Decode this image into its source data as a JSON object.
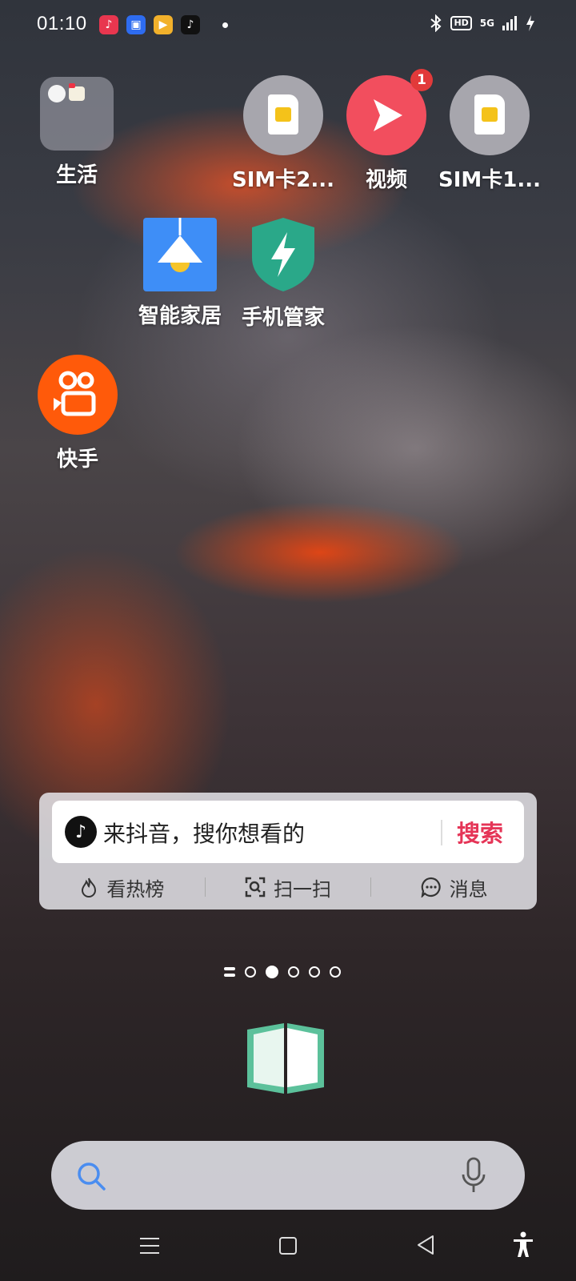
{
  "status_bar": {
    "time": "01:10",
    "notification_icons": [
      "music-icon",
      "gallery-icon",
      "video-app-icon",
      "tiktok-icon"
    ],
    "network_type": "5G",
    "hd_label": "HD"
  },
  "apps": {
    "life_folder": {
      "label": "生活"
    },
    "sim2": {
      "label": "SIM卡2..."
    },
    "video": {
      "label": "视频",
      "badge": "1"
    },
    "sim1": {
      "label": "SIM卡1..."
    },
    "smart_home": {
      "label": "智能家居"
    },
    "phone_manager": {
      "label": "手机管家"
    },
    "kuaishou": {
      "label": "快手"
    }
  },
  "douyin_widget": {
    "placeholder": "来抖音，搜你想看的",
    "search_button": "搜索",
    "actions": [
      "看热榜",
      "扫一扫",
      "消息"
    ]
  },
  "page_indicator": {
    "pages": 5,
    "current": 1
  },
  "colors": {
    "video_icon": "#f24e5e",
    "kuaishou_icon": "#ff5a0a",
    "phone_manager_icon": "#2aa889",
    "smart_home_icon": "#3e8ef7",
    "search_accent": "#e53557",
    "search_icon": "#4a8df0"
  }
}
